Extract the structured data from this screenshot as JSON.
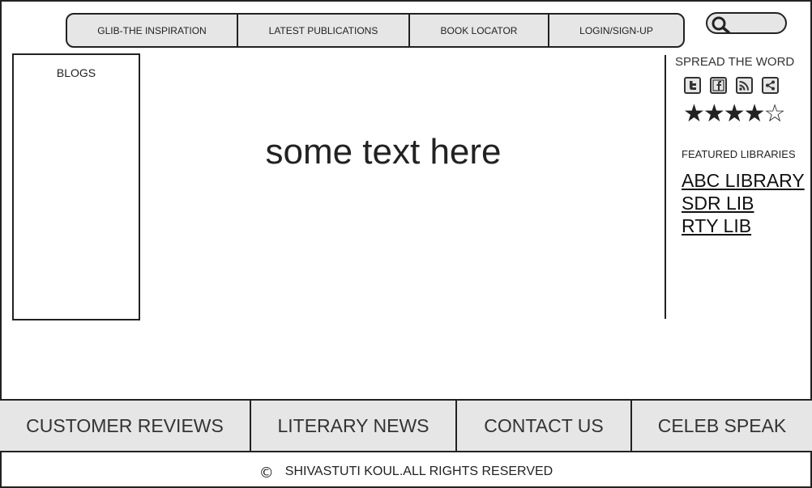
{
  "top_nav": {
    "items": [
      {
        "label": "GLIB-THE INSPIRATION"
      },
      {
        "label": "LATEST PUBLICATIONS"
      },
      {
        "label": "BOOK LOCATOR"
      },
      {
        "label": "LOGIN/SIGN-UP"
      }
    ]
  },
  "search": {
    "icon": "search-icon",
    "value": "",
    "placeholder": ""
  },
  "blogs": {
    "title": "BLOGS"
  },
  "main": {
    "text": "some text here"
  },
  "sidebar": {
    "spread_title": "SPREAD THE WORD",
    "social_icons": [
      "twitter-icon",
      "facebook-icon",
      "rss-icon",
      "share-icon"
    ],
    "rating": {
      "value": 4,
      "max": 5,
      "display": "★★★★☆"
    },
    "featured_title": "FEATURED LIBRARIES",
    "libraries": [
      {
        "label": "ABC LIBRARY"
      },
      {
        "label": "SDR LIB"
      },
      {
        "label": "RTY LIB"
      }
    ]
  },
  "bottom_nav": {
    "items": [
      {
        "label": "CUSTOMER REVIEWS"
      },
      {
        "label": "LITERARY NEWS"
      },
      {
        "label": "CONTACT US"
      },
      {
        "label": "CELEB SPEAK"
      }
    ]
  },
  "footer": {
    "copyright_symbol": "©",
    "text": "SHIVASTUTI KOUL.ALL RIGHTS RESERVED"
  }
}
